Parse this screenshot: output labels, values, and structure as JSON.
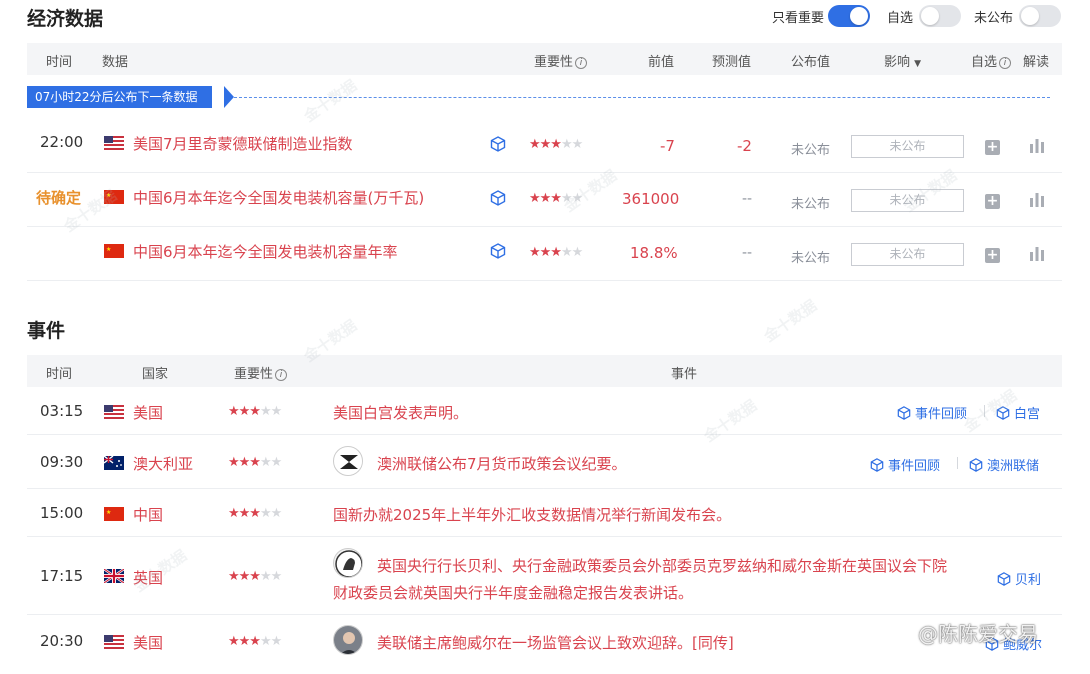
{
  "econ": {
    "title": "经济数据",
    "toggles": [
      {
        "label": "只看重要",
        "on": true
      },
      {
        "label": "自选",
        "on": false
      },
      {
        "label": "未公布",
        "on": false
      }
    ],
    "headers": {
      "time": "时间",
      "data": "数据",
      "importance": "重要性",
      "prev": "前值",
      "forecast": "预测值",
      "actual": "公布值",
      "impact": "影响",
      "watch": "自选",
      "explain": "解读"
    },
    "banner": "07小时22分后公布下一条数据",
    "rows": [
      {
        "time": "22:00",
        "country": "us",
        "name": "美国7月里奇蒙德联储制造业指数",
        "stars": 3,
        "prev": "-7",
        "forecast": "-2",
        "actual": "未公布",
        "impact": "未公布"
      },
      {
        "time": "待确定",
        "country": "cn",
        "name": "中国6月本年迄今全国发电装机容量(万千瓦)",
        "stars": 3,
        "prev": "361000",
        "forecast": "--",
        "actual": "未公布",
        "impact": "未公布"
      },
      {
        "time": "",
        "country": "cn",
        "name": "中国6月本年迄今全国发电装机容量年率",
        "stars": 3,
        "prev": "18.8%",
        "forecast": "--",
        "actual": "未公布",
        "impact": "未公布"
      }
    ]
  },
  "events": {
    "title": "事件",
    "headers": {
      "time": "时间",
      "country": "国家",
      "importance": "重要性",
      "event": "事件"
    },
    "rows": [
      {
        "time": "03:15",
        "country": "us",
        "country_name": "美国",
        "stars": 3,
        "text": "美国白宫发表声明。",
        "text2": "",
        "avatar": "",
        "links": [
          "事件回顾",
          "白宫"
        ]
      },
      {
        "time": "09:30",
        "country": "au",
        "country_name": "澳大利亚",
        "stars": 3,
        "text": "澳洲联储公布7月货币政策会议纪要。",
        "text2": "",
        "avatar": "rba-logo",
        "links": [
          "事件回顾",
          "澳洲联储"
        ]
      },
      {
        "time": "15:00",
        "country": "cn",
        "country_name": "中国",
        "stars": 3,
        "text": "国新办就2025年上半年外汇收支数据情况举行新闻发布会。",
        "text2": "",
        "avatar": "",
        "links": []
      },
      {
        "time": "17:15",
        "country": "uk",
        "country_name": "英国",
        "stars": 3,
        "text": "英国央行行长贝利、央行金融政策委员会外部委员克罗兹纳和威尔金斯在英国议会下院",
        "text2": "财政委员会就英国央行半年度金融稳定报告发表讲话。",
        "avatar": "boe-logo",
        "links": [
          "贝利"
        ]
      },
      {
        "time": "20:30",
        "country": "us",
        "country_name": "美国",
        "stars": 3,
        "text": "美联储主席鲍威尔在一场监管会议上致欢迎辞。[同传]",
        "text2": "",
        "avatar": "powell-photo",
        "links": [
          "鲍威尔"
        ]
      }
    ]
  },
  "watermark": {
    "brand": "金十数据",
    "author": "@陈陈爱交易"
  },
  "colors": {
    "accent": "#2f6fe4",
    "red": "#d9434e",
    "orange": "#e8912d"
  }
}
